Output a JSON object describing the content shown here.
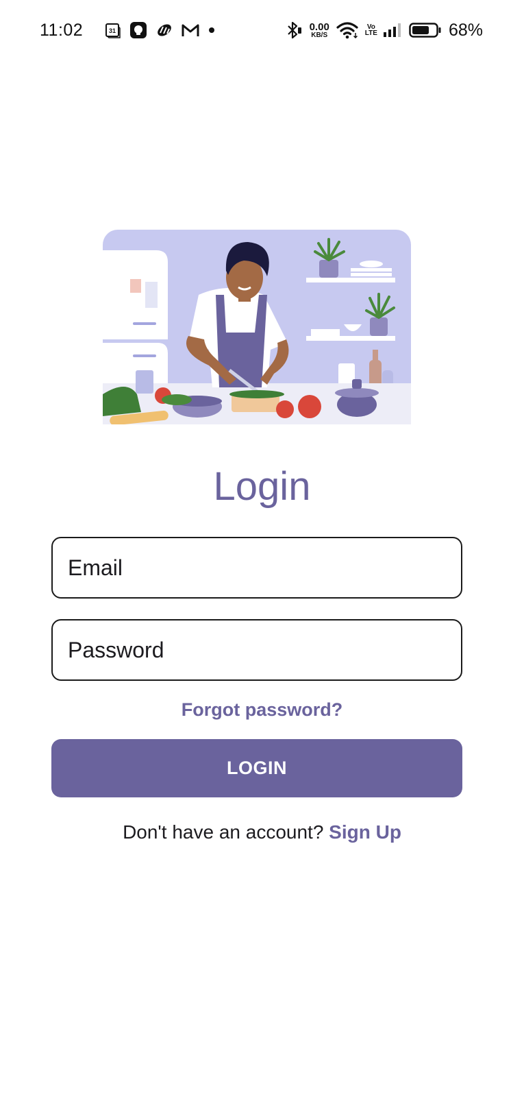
{
  "status_bar": {
    "time": "11:02",
    "calendar_day": "31",
    "net_speed_value": "0.00",
    "net_speed_unit": "KB/S",
    "volte_top": "Vo",
    "volte_bottom": "LTE",
    "battery_percent": "68%",
    "icons": [
      "calendar-icon",
      "chat-bubble-icon",
      "pinwheel-icon",
      "gmail-icon",
      "notification-dot-icon",
      "bluetooth-icon",
      "wifi-icon",
      "signal-icon",
      "battery-icon"
    ]
  },
  "hero": {
    "icon": "kitchen-chef-illustration",
    "colors": {
      "background": "#c7c9f0",
      "apron": "#6a639d",
      "counter": "#ededf7"
    }
  },
  "login": {
    "title": "Login",
    "email_placeholder": "Email",
    "password_placeholder": "Password",
    "forgot_label": "Forgot password?",
    "submit_label": "LOGIN",
    "signup_prompt": "Don't have an account? ",
    "signup_link": "Sign Up"
  },
  "theme": {
    "accent": "#6a639d",
    "button_text": "#ffffff",
    "field_border": "#1a1a1a"
  }
}
